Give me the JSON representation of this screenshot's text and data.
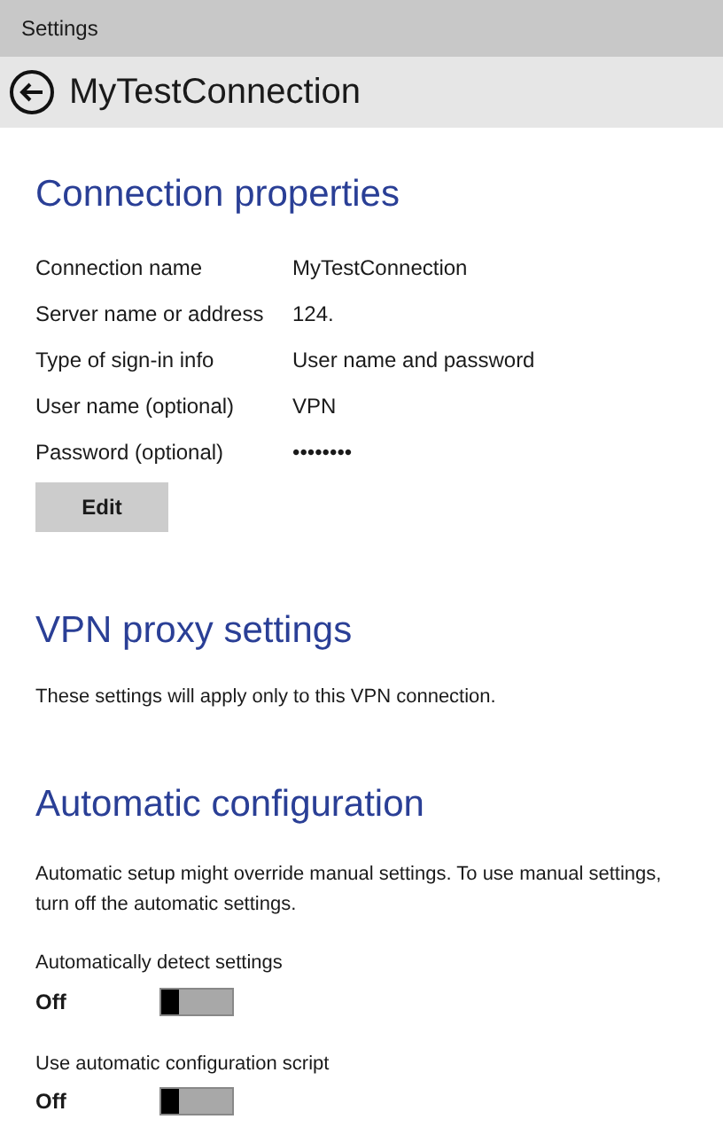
{
  "window": {
    "title": "Settings"
  },
  "header": {
    "title": "MyTestConnection"
  },
  "connection_properties": {
    "heading": "Connection properties",
    "rows": [
      {
        "label": "Connection name",
        "value": "MyTestConnection"
      },
      {
        "label": "Server name or address",
        "value": "124."
      },
      {
        "label": "Type of sign-in info",
        "value": "User name and password"
      },
      {
        "label": "User name (optional)",
        "value": "VPN"
      },
      {
        "label": "Password (optional)",
        "value": "••••••••"
      }
    ],
    "button": "Edit"
  },
  "vpn_proxy": {
    "heading": "VPN proxy settings",
    "description": "These settings will apply only to this VPN connection."
  },
  "automatic_configuration": {
    "heading": "Automatic configuration",
    "description": "Automatic setup might override manual settings. To use manual settings, turn off the automatic settings.",
    "toggles": [
      {
        "label": "Automatically detect settings",
        "state_text": "Off",
        "on": false
      },
      {
        "label": "Use automatic configuration script",
        "state_text": "Off",
        "on": false
      }
    ]
  }
}
